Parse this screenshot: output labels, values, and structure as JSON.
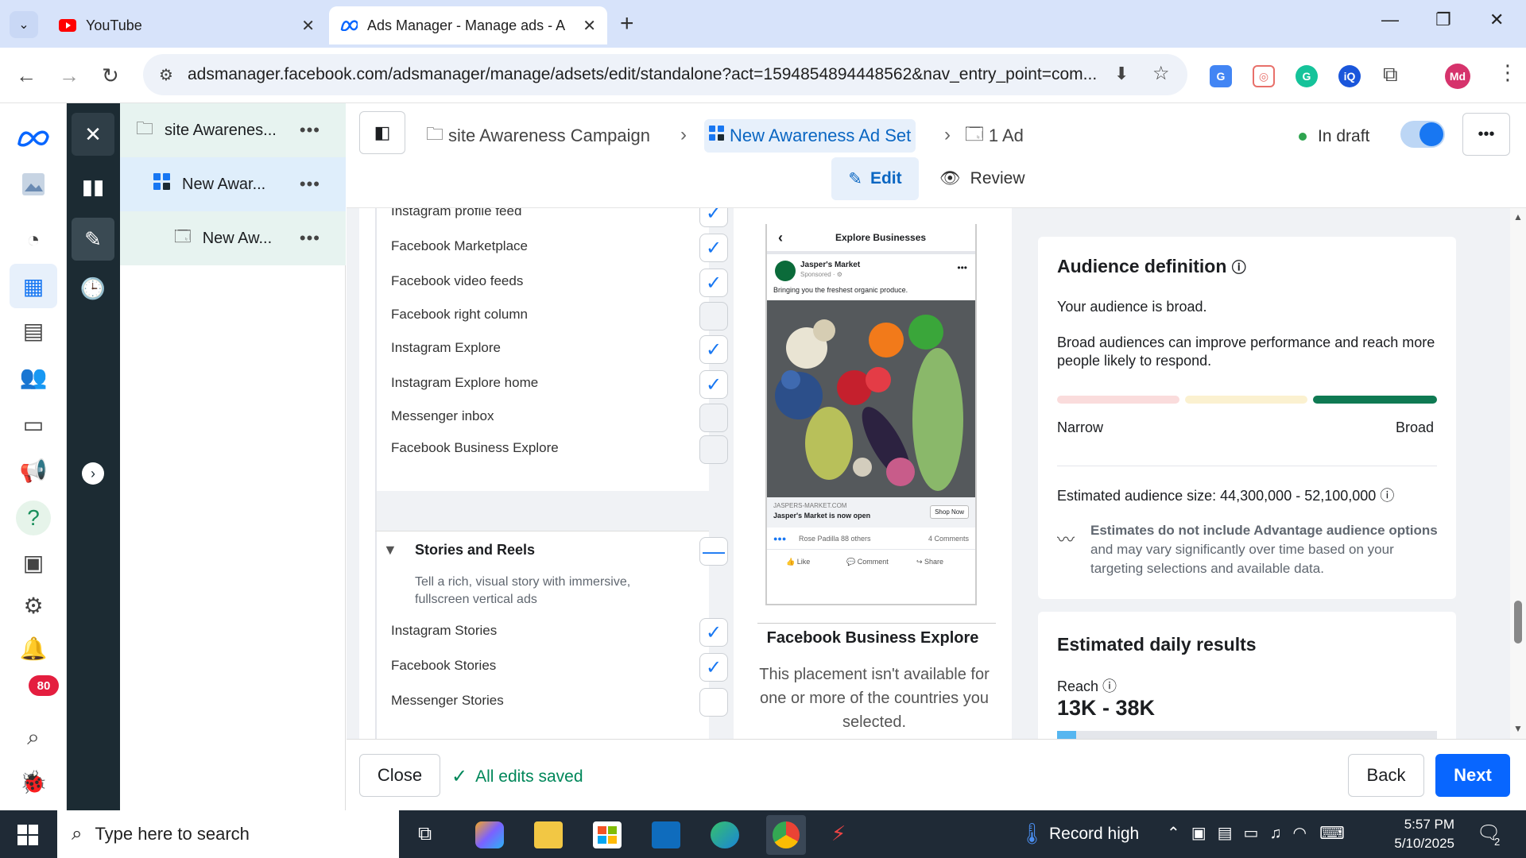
{
  "browser": {
    "tabs": [
      {
        "title": "YouTube"
      },
      {
        "title": "Ads Manager - Manage ads - A"
      }
    ],
    "url": "adsmanager.facebook.com/adsmanager/manage/adsets/edit/standalone?act=1594854894448562&nav_entry_point=com...",
    "profile_initials": "Md"
  },
  "tree": {
    "items": [
      {
        "label": "site Awarenes..."
      },
      {
        "label": "New Awar..."
      },
      {
        "label": "New Aw..."
      }
    ]
  },
  "header": {
    "breadcrumbs": [
      {
        "label": "site Awareness Campaign"
      },
      {
        "label": "New Awareness Ad Set"
      },
      {
        "label": "1 Ad"
      }
    ],
    "status": "In draft",
    "edit_label": "Edit",
    "review_label": "Review"
  },
  "placements": {
    "items": [
      {
        "label": "Instagram profile feed",
        "state": "checked"
      },
      {
        "label": "Facebook Marketplace",
        "state": "checked"
      },
      {
        "label": "Facebook video feeds",
        "state": "checked"
      },
      {
        "label": "Facebook right column",
        "state": "disabled"
      },
      {
        "label": "Instagram Explore",
        "state": "checked"
      },
      {
        "label": "Instagram Explore home",
        "state": "checked"
      },
      {
        "label": "Messenger inbox",
        "state": "disabled"
      },
      {
        "label": "Facebook Business Explore",
        "state": "disabled"
      }
    ],
    "section": {
      "title": "Stories and Reels",
      "description": "Tell a rich, visual story with immersive, fullscreen vertical ads"
    },
    "stories": [
      {
        "label": "Instagram Stories",
        "state": "checked"
      },
      {
        "label": "Facebook Stories",
        "state": "checked"
      },
      {
        "label": "Messenger Stories",
        "state": "unchecked"
      }
    ]
  },
  "preview": {
    "phone_title": "Explore Businesses",
    "page_name": "Jasper's Market",
    "sponsored": "Sponsored · ⚙",
    "post_text": "Bringing you the freshest organic produce.",
    "domain": "JASPERS-MARKET.COM",
    "headline": "Jasper's Market is now open",
    "cta": "Shop Now",
    "reactions": "Rose Padilla 88 others",
    "comments": "4 Comments",
    "like": "Like",
    "comment": "Comment",
    "share": "Share",
    "placement_title": "Facebook Business Explore",
    "placement_note": "This placement isn't available for one or more of the countries you selected."
  },
  "audience": {
    "title": "Audience definition",
    "broad_text": "Your audience is broad.",
    "description": "Broad audiences can improve performance and reach more people likely to respond.",
    "narrow_label": "Narrow",
    "broad_label": "Broad",
    "size_text": "Estimated audience size: 44,300,000 - 52,100,000",
    "estimate_bold": "Estimates do not include Advantage audience options",
    "estimate_rest": " and may vary significantly over time based on your targeting selections and available data."
  },
  "daily": {
    "title": "Estimated daily results",
    "reach_label": "Reach",
    "reach_value": "13K - 38K"
  },
  "footer": {
    "close_label": "Close",
    "saved_label": "All edits saved",
    "back_label": "Back",
    "next_label": "Next"
  },
  "taskbar": {
    "search_placeholder": "Type here to search",
    "weather": "Record high",
    "time": "5:57 PM",
    "date": "5/10/2025",
    "notif_count": "80",
    "chat_count": "2"
  },
  "colors": {
    "accent": "#1877f2",
    "dark_rail": "#1c2b33",
    "selected_bg": "#e7f3f0",
    "green": "#00875a"
  }
}
